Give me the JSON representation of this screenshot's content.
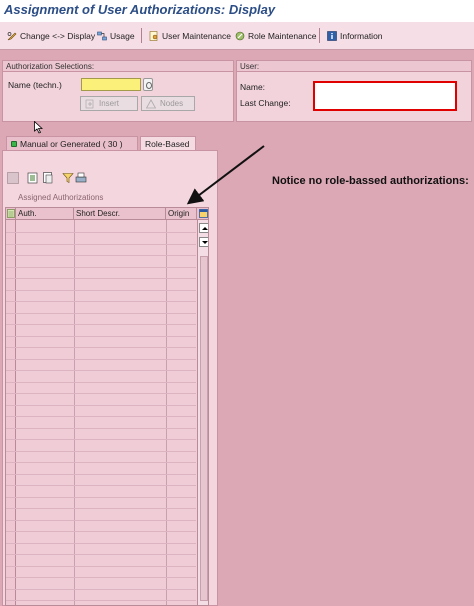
{
  "window": {
    "title": "Assignment of User Authorizations: Display"
  },
  "toolbar": {
    "change_display": "Change <-> Display",
    "usage": "Usage",
    "user_maintenance": "User Maintenance",
    "role_maintenance": "Role Maintenance",
    "information": "Information"
  },
  "auth_selections": {
    "header": "Authorization Selections:",
    "name_label": "Name (techn.)",
    "name_value": "",
    "insert_label": "Insert",
    "nodes_label": "Nodes"
  },
  "user_panel": {
    "header": "User:",
    "name_label": "Name:",
    "last_change_label": "Last Change:"
  },
  "tabs": [
    {
      "label": "Manual or Generated ( 30 )",
      "active": false
    },
    {
      "label": "Role-Based",
      "active": true
    }
  ],
  "assigned": {
    "section_label": "Assigned Authorizations",
    "columns": [
      "Auth.",
      "Short Descr.",
      "Origin"
    ],
    "rows": []
  },
  "annotation": {
    "text": "Notice no role-bassed authorizations:"
  },
  "colors": {
    "background": "#dca8b6",
    "highlight": "#e00000",
    "title": "#2c4e86"
  }
}
